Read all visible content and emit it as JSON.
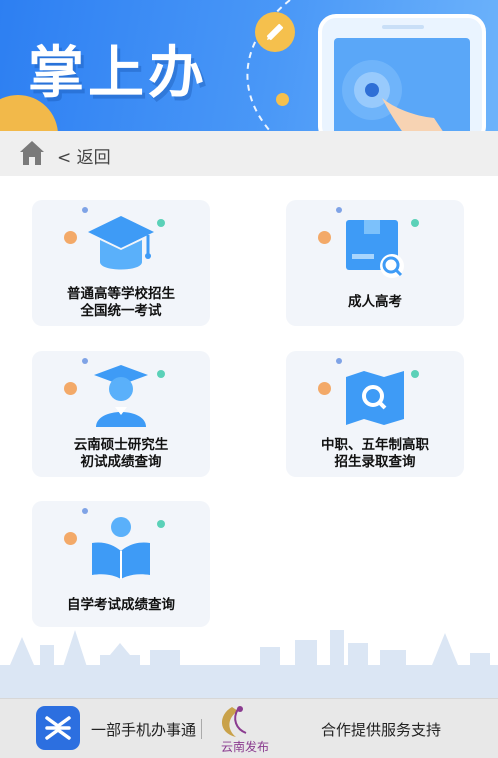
{
  "banner": {
    "title": "掌上办"
  },
  "nav": {
    "back_label": "< 返回"
  },
  "services": [
    {
      "line1": "普通高等学校招生",
      "line2": "全国统一考试",
      "icon": "graduation-cap-icon"
    },
    {
      "line1": "成人高考",
      "line2": "",
      "icon": "id-card-search-icon"
    },
    {
      "line1": "云南硕士研究生",
      "line2": "初试成绩查询",
      "icon": "graduate-student-icon"
    },
    {
      "line1": "中职、五年制高职",
      "line2": "招生录取查询",
      "icon": "map-search-icon"
    },
    {
      "line1": "自学考试成绩查询",
      "line2": "",
      "icon": "reading-person-icon"
    }
  ],
  "footer": {
    "app_text": "一部手机办事通",
    "partner_text": "云南发布",
    "support_text": "合作提供服务支持"
  },
  "colors": {
    "banner_blue": "#2d7ff2",
    "icon_blue": "#3e9bf6",
    "card_bg": "#f2f5fa",
    "nav_bg": "#efefef",
    "footer_bg": "#e8e8e8"
  }
}
